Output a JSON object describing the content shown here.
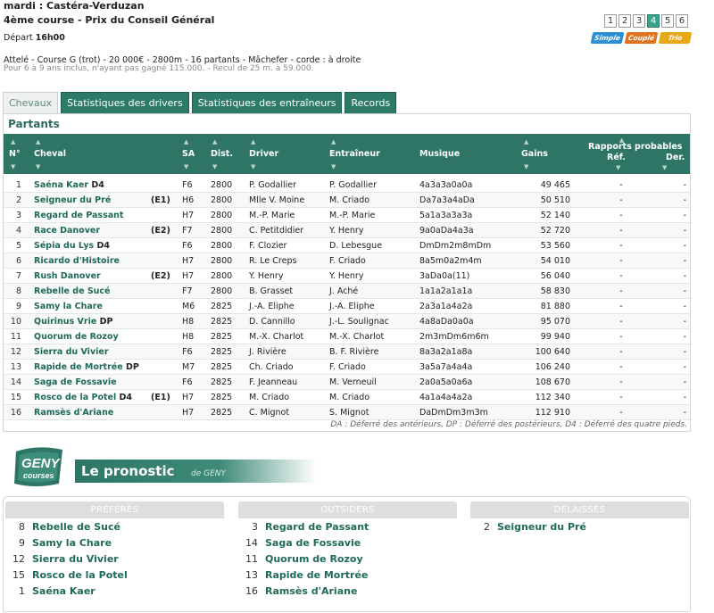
{
  "header": {
    "line1": "mardi :  Castéra-Verduzan",
    "line2": "4ème course - Prix du Conseil Général",
    "depart_label": "Départ",
    "depart_time": "16h00",
    "conditions": "Attelé - Course G (trot) - 20 000€ - 2800m - 16 partants - Mâchefer - corde : à droite",
    "conditions_sub": "Pour 6 à 9 ans inclus, n'ayant pas gagné 115.000. - Recul de 25 m. à 59.000."
  },
  "race_numbers": [
    "1",
    "2",
    "3",
    "4",
    "5",
    "6"
  ],
  "active_race": "4",
  "bet_types": [
    {
      "label": "Simple",
      "color": "#2a8fd6"
    },
    {
      "label": "Couplé",
      "color": "#e0731f"
    },
    {
      "label": "Trio",
      "color": "#e9a71a"
    }
  ],
  "tabs": [
    "Chevaux",
    "Statistiques des drivers",
    "Statistiques des entraîneurs",
    "Records"
  ],
  "partants_title": "Partants",
  "columns": {
    "num": "N°",
    "cheval": "Cheval",
    "sa": "SA",
    "dist": "Dist.",
    "driver": "Driver",
    "entraineur": "Entraîneur",
    "musique": "Musique",
    "gains": "Gains",
    "rapports": "Rapports probables",
    "ref": "Réf.",
    "der": "Der."
  },
  "runners": [
    {
      "num": "1",
      "name": "Saéna Kaer",
      "tag": "D4",
      "ecurie": "",
      "sa": "F6",
      "dist": "2800",
      "driver": "P. Godallier",
      "entraineur": "P. Godallier",
      "musique": "4a3a3a0a0a",
      "gains": "49 465",
      "ref": "-",
      "der": "-"
    },
    {
      "num": "2",
      "name": "Seigneur du Pré",
      "tag": "",
      "ecurie": "(E1)",
      "sa": "H6",
      "dist": "2800",
      "driver": "Mlle V. Moine",
      "entraineur": "M. Criado",
      "musique": "Da7a3a4aDa",
      "gains": "50 510",
      "ref": "-",
      "der": "-"
    },
    {
      "num": "3",
      "name": "Regard de Passant",
      "tag": "",
      "ecurie": "",
      "sa": "H7",
      "dist": "2800",
      "driver": "M.-P. Marie",
      "entraineur": "M.-P. Marie",
      "musique": "5a1a3a3a3a",
      "gains": "52 140",
      "ref": "-",
      "der": "-"
    },
    {
      "num": "4",
      "name": "Race Danover",
      "tag": "",
      "ecurie": "(E2)",
      "sa": "F7",
      "dist": "2800",
      "driver": "C. Petitdidier",
      "entraineur": "Y. Henry",
      "musique": "9a0aDa4a3a",
      "gains": "52 720",
      "ref": "-",
      "der": "-"
    },
    {
      "num": "5",
      "name": "Sépia du Lys",
      "tag": "D4",
      "ecurie": "",
      "sa": "F6",
      "dist": "2800",
      "driver": "F. Clozier",
      "entraineur": "D. Lebesgue",
      "musique": "DmDm2m8mDm",
      "gains": "53 560",
      "ref": "-",
      "der": "-"
    },
    {
      "num": "6",
      "name": "Ricardo d'Histoire",
      "tag": "",
      "ecurie": "",
      "sa": "H7",
      "dist": "2800",
      "driver": "R. Le Creps",
      "entraineur": "F. Criado",
      "musique": "8a5m0a2m4m",
      "gains": "54 010",
      "ref": "-",
      "der": "-"
    },
    {
      "num": "7",
      "name": "Rush Danover",
      "tag": "",
      "ecurie": "(E2)",
      "sa": "H7",
      "dist": "2800",
      "driver": "Y. Henry",
      "entraineur": "Y. Henry",
      "musique": "3aDa0a(11)",
      "gains": "56 040",
      "ref": "-",
      "der": "-"
    },
    {
      "num": "8",
      "name": "Rebelle de Sucé",
      "tag": "",
      "ecurie": "",
      "sa": "F7",
      "dist": "2800",
      "driver": "B. Grasset",
      "entraineur": "J. Aché",
      "musique": "1a1a2a1a1a",
      "gains": "58 830",
      "ref": "-",
      "der": "-"
    },
    {
      "num": "9",
      "name": "Samy la Chare",
      "tag": "",
      "ecurie": "",
      "sa": "M6",
      "dist": "2825",
      "driver": "J.-A. Eliphe",
      "entraineur": "J.-A. Eliphe",
      "musique": "2a3a1a4a2a",
      "gains": "81 880",
      "ref": "-",
      "der": "-"
    },
    {
      "num": "10",
      "name": "Quirinus Vrie",
      "tag": "DP",
      "ecurie": "",
      "sa": "H8",
      "dist": "2825",
      "driver": "D. Cannillo",
      "entraineur": "J.-L. Soulignac",
      "musique": "4a8aDa0a0a",
      "gains": "95 070",
      "ref": "-",
      "der": "-"
    },
    {
      "num": "11",
      "name": "Quorum de Rozoy",
      "tag": "",
      "ecurie": "",
      "sa": "H8",
      "dist": "2825",
      "driver": "M.-X. Charlot",
      "entraineur": "M.-X. Charlot",
      "musique": "2m3mDm6m6m",
      "gains": "99 940",
      "ref": "-",
      "der": "-"
    },
    {
      "num": "12",
      "name": "Sierra du Vivier",
      "tag": "",
      "ecurie": "",
      "sa": "F6",
      "dist": "2825",
      "driver": "J. Rivière",
      "entraineur": "B. F. Rivière",
      "musique": "8a3a2a1a8a",
      "gains": "100 640",
      "ref": "-",
      "der": "-"
    },
    {
      "num": "13",
      "name": "Rapide de Mortrée",
      "tag": "DP",
      "ecurie": "",
      "sa": "M7",
      "dist": "2825",
      "driver": "Ch. Criado",
      "entraineur": "F. Criado",
      "musique": "3a5a7a4a4a",
      "gains": "106 240",
      "ref": "-",
      "der": "-"
    },
    {
      "num": "14",
      "name": "Saga de Fossavie",
      "tag": "",
      "ecurie": "",
      "sa": "F6",
      "dist": "2825",
      "driver": "F. Jeanneau",
      "entraineur": "M. Verneuil",
      "musique": "2a0a5a0a6a",
      "gains": "108 670",
      "ref": "-",
      "der": "-"
    },
    {
      "num": "15",
      "name": "Rosco de la Potel",
      "tag": "D4",
      "ecurie": "(E1)",
      "sa": "H7",
      "dist": "2825",
      "driver": "M. Criado",
      "entraineur": "M. Criado",
      "musique": "4a1a4a4a2a",
      "gains": "112 340",
      "ref": "-",
      "der": "-"
    },
    {
      "num": "16",
      "name": "Ramsès d'Ariane",
      "tag": "",
      "ecurie": "",
      "sa": "H7",
      "dist": "2825",
      "driver": "C. Mignot",
      "entraineur": "S. Mignot",
      "musique": "DaDmDm3m3m",
      "gains": "112 910",
      "ref": "-",
      "der": "-"
    }
  ],
  "legend_note": "DA : Déferré des antérieurs, DP : Déferré des postérieurs, D4 : Déferré des quatre pieds.",
  "pronostic": {
    "logo_top": "GENY",
    "logo_bottom": "courses",
    "title": "Le pronostic",
    "subtitle": "de GENY",
    "columns": [
      {
        "header": "PRÉFÉRÉS",
        "items": [
          {
            "num": "8",
            "name": "Rebelle de Sucé"
          },
          {
            "num": "9",
            "name": "Samy la Chare"
          },
          {
            "num": "12",
            "name": "Sierra du Vivier"
          },
          {
            "num": "15",
            "name": "Rosco de la Potel"
          },
          {
            "num": "1",
            "name": "Saéna Kaer"
          }
        ]
      },
      {
        "header": "OUTSIDERS",
        "items": [
          {
            "num": "3",
            "name": "Regard de Passant"
          },
          {
            "num": "14",
            "name": "Saga de Fossavie"
          },
          {
            "num": "11",
            "name": "Quorum de Rozoy"
          },
          {
            "num": "13",
            "name": "Rapide de Mortrée"
          },
          {
            "num": "16",
            "name": "Ramsès d'Ariane"
          }
        ]
      },
      {
        "header": "DÉLAISSÉS",
        "items": [
          {
            "num": "2",
            "name": "Seigneur du Pré"
          }
        ]
      }
    ]
  }
}
